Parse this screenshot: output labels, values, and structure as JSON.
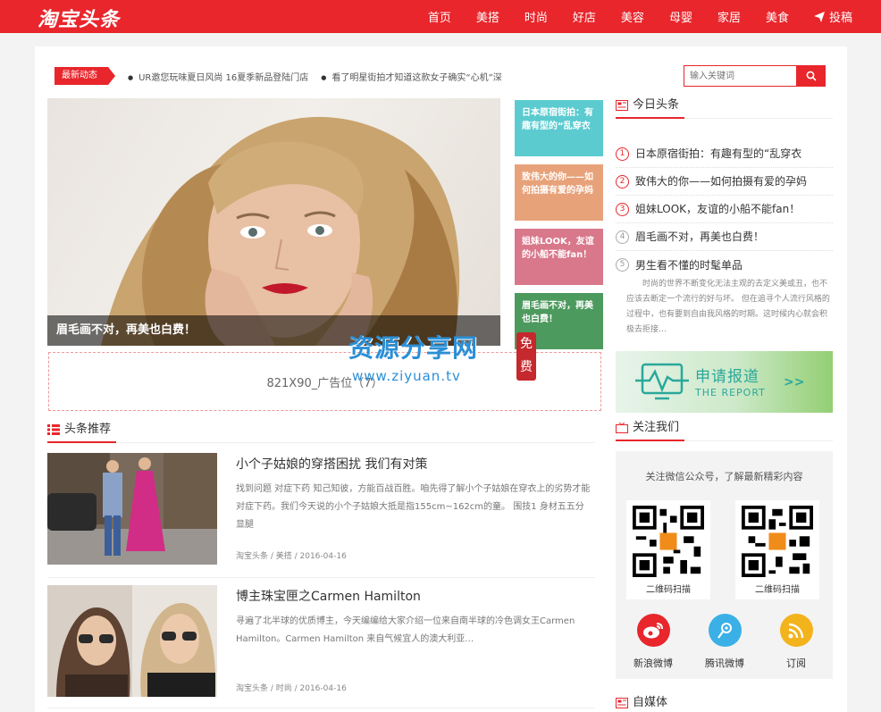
{
  "header": {
    "logo": "淘宝头条",
    "nav": [
      "首页",
      "美搭",
      "时尚",
      "好店",
      "美容",
      "母婴",
      "家居",
      "美食"
    ],
    "contribute": "投稿"
  },
  "ticker": {
    "badge": "最新动态",
    "items": [
      "UR邀您玩味夏日风尚 16夏季新品登陆门店",
      "看了明星街拍才知道这款女子确实“心机”深"
    ]
  },
  "search": {
    "placeholder": "输入关键词"
  },
  "hero": {
    "caption": "眉毛画不对，再美也白费！",
    "tiles": [
      {
        "text": "日本原宿街拍：有趣有型的“乱穿衣",
        "color": "#5bcbd0"
      },
      {
        "text": "致伟大的你——如何拍摄有爱的孕妈",
        "color": "#e8a27a"
      },
      {
        "text": "姐妹LOOK，友谊的小船不能fan！",
        "color": "#d9788b"
      },
      {
        "text": "眉毛画不对，再美也白费！",
        "color": "#4d9a5e"
      }
    ]
  },
  "ad": {
    "text": "821X90_广告位（7）"
  },
  "recommend": {
    "title": "头条推荐",
    "articles": [
      {
        "title": "小个子姑娘的穿搭困扰 我们有对策",
        "excerpt": "找到问题 对症下药 知己知彼，方能百战百胜。咱先得了解小个子姑娘在穿衣上的劣势才能对症下药。我们今天说的小个子姑娘大抵是指155cm~162cm的童。 围技1 身材五五分 显腿",
        "meta": "淘宝头条 / 美搭 / 2016-04-16"
      },
      {
        "title": "博主珠宝匣之Carmen Hamilton",
        "excerpt": "寻遍了北半球的优质博主，今天编编给大家介绍一位来自南半球的冷色调女王Carmen Hamilton。Carmen Hamilton 来自气候宜人的澳大利亚…",
        "meta": "淘宝头条 / 时尚 / 2016-04-16"
      }
    ]
  },
  "today": {
    "title": "今日头条",
    "items": [
      "日本原宿街拍：有趣有型的“乱穿衣",
      "致伟大的你——如何拍摄有爱的孕妈",
      "姐妹LOOK，友谊的小船不能fan！",
      "眉毛画不对，再美也白费！",
      "男生看不懂的时髦单品"
    ],
    "intro": "时尚的世界不断变化无法主观的去定义美或丑，也不应该去断定一个流行的好与坏。 但在追寻个人流行风格的过程中，也有要到自由我风格的时期。这时候内心就会积极去拒接…"
  },
  "report": {
    "cn": "申请报道",
    "en": "THE REPORT",
    "arrow": ">>"
  },
  "follow": {
    "title": "关注我们",
    "desc": "关注微信公众号，了解最新精彩内容",
    "qr_labels": [
      "二维码扫描",
      "二维码扫描"
    ],
    "social": [
      {
        "label": "新浪微博",
        "color": "#e8262c"
      },
      {
        "label": "腾讯微博",
        "color": "#3ab0e6"
      },
      {
        "label": "订阅",
        "color": "#f3b31c"
      }
    ]
  },
  "media": {
    "title": "自媒体"
  },
  "watermark": {
    "cn": "资源分享网",
    "url": "www.ziyuan.tv",
    "stamp": "免费"
  }
}
